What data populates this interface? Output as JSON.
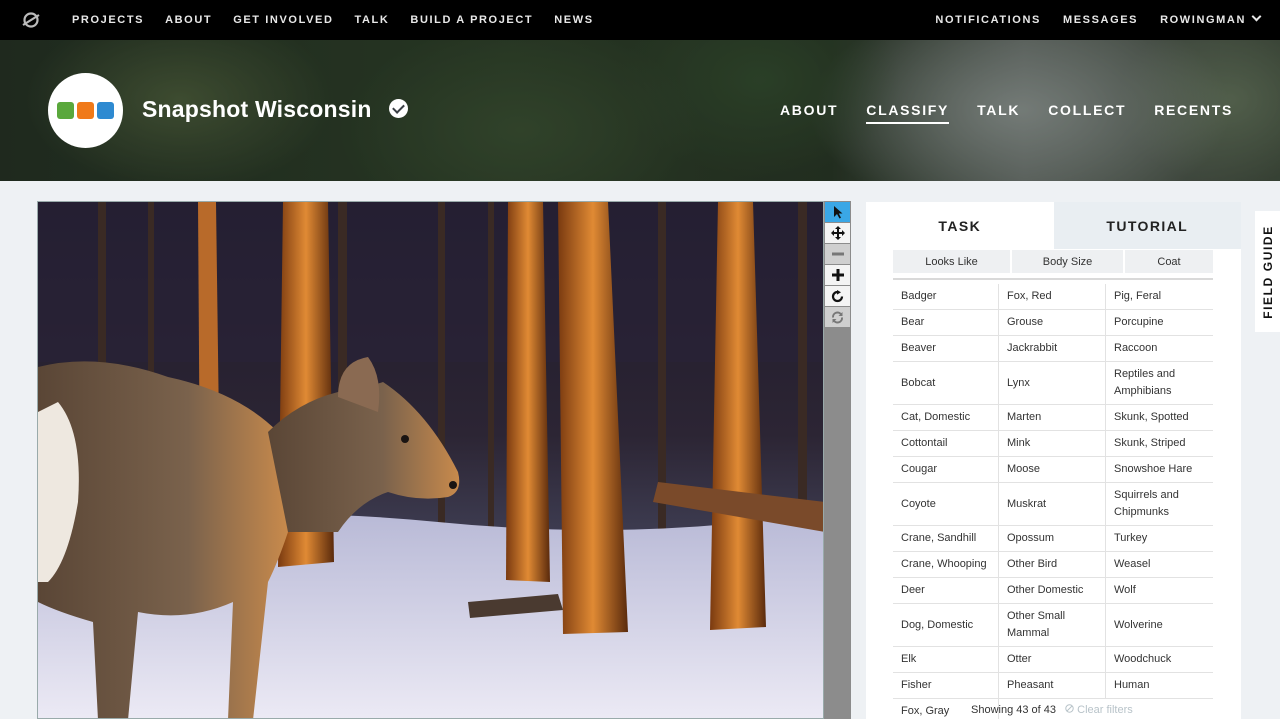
{
  "topnav": {
    "left_links": [
      "PROJECTS",
      "ABOUT",
      "GET INVOLVED",
      "TALK",
      "BUILD A PROJECT",
      "NEWS"
    ],
    "right_links": [
      "NOTIFICATIONS",
      "MESSAGES",
      "ROWINGMAN"
    ]
  },
  "project": {
    "title": "Snapshot Wisconsin",
    "nav": [
      "ABOUT",
      "CLASSIFY",
      "TALK",
      "COLLECT",
      "RECENTS"
    ],
    "active_nav": "CLASSIFY",
    "logo_colors": [
      "#5aa83c",
      "#f07a1a",
      "#2e8ad1"
    ]
  },
  "tools": [
    "pointer-icon",
    "pan-icon",
    "zoom-out-icon",
    "zoom-in-icon",
    "rotate-icon",
    "reset-icon"
  ],
  "task": {
    "tabs": [
      "TASK",
      "TUTORIAL"
    ],
    "filters": [
      "Looks Like",
      "Body Size",
      "Coat"
    ],
    "choices": [
      [
        "Badger",
        "Fox, Red",
        "Pig, Feral"
      ],
      [
        "Bear",
        "Grouse",
        "Porcupine"
      ],
      [
        "Beaver",
        "Jackrabbit",
        "Raccoon"
      ],
      [
        "Bobcat",
        "Lynx",
        "Reptiles and Amphibians"
      ],
      [
        "Cat, Domestic",
        "Marten",
        "Skunk, Spotted"
      ],
      [
        "Cottontail",
        "Mink",
        "Skunk, Striped"
      ],
      [
        "Cougar",
        "Moose",
        "Snowshoe Hare"
      ],
      [
        "Coyote",
        "Muskrat",
        "Squirrels and Chipmunks"
      ],
      [
        "Crane, Sandhill",
        "Opossum",
        "Turkey"
      ],
      [
        "Crane, Whooping",
        "Other Bird",
        "Weasel"
      ],
      [
        "Deer",
        "Other Domestic",
        "Wolf"
      ],
      [
        "Dog, Domestic",
        "Other Small Mammal",
        "Wolverine"
      ],
      [
        "Elk",
        "Otter",
        "Woodchuck"
      ],
      [
        "Fisher",
        "Pheasant",
        "Human"
      ],
      [
        "Fox, Gray",
        "",
        ""
      ]
    ],
    "showing": "Showing 43 of 43",
    "clear_filters": "Clear filters"
  },
  "field_guide": "FIELD GUIDE"
}
